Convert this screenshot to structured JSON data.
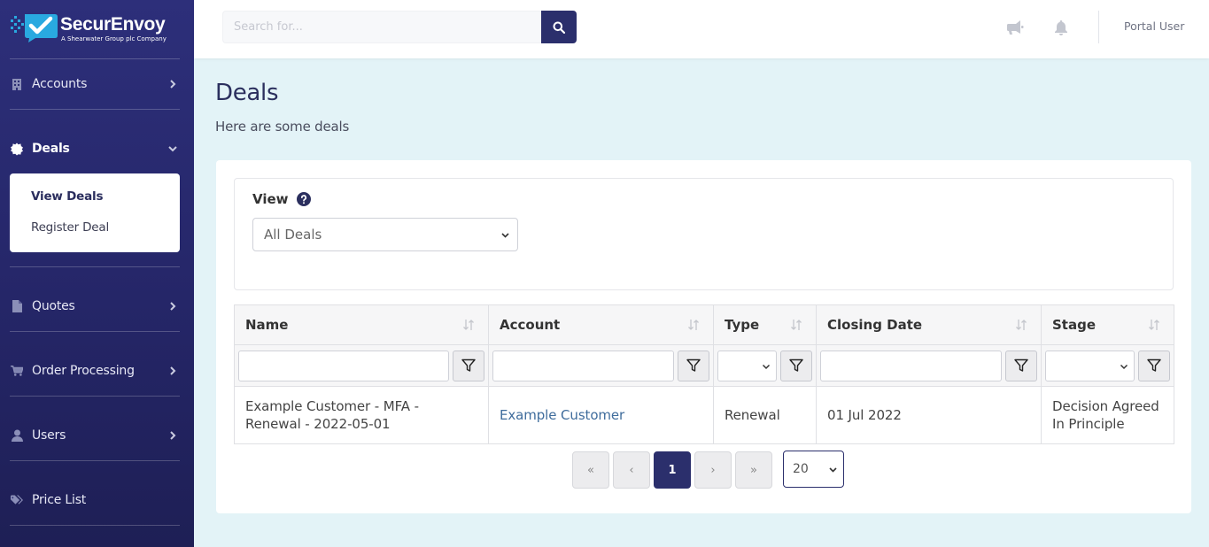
{
  "brand": {
    "name": "SecurEnvoy",
    "tagline": "A Shearwater Group plc Company",
    "accent": "#2b2f6c",
    "logo_blue": "#29a9e0"
  },
  "sidebar": {
    "items": [
      {
        "label": "Accounts",
        "icon": "building-icon"
      },
      {
        "label": "Deals",
        "icon": "badge-icon"
      },
      {
        "label": "Quotes",
        "icon": "file-icon"
      },
      {
        "label": "Order Processing",
        "icon": "cart-icon"
      },
      {
        "label": "Users",
        "icon": "user-icon"
      },
      {
        "label": "Price List",
        "icon": "tags-icon"
      }
    ],
    "deals_submenu": [
      {
        "label": "View Deals"
      },
      {
        "label": "Register Deal"
      }
    ]
  },
  "header": {
    "search_placeholder": "Search for...",
    "user": "Portal User"
  },
  "main": {
    "title": "Deals",
    "subtitle": "Here are some deals",
    "view_label": "View",
    "view_selected": "All Deals"
  },
  "table": {
    "columns": [
      "Name",
      "Account",
      "Type",
      "Closing Date",
      "Stage"
    ],
    "rows": [
      {
        "name": "Example Customer - MFA - Renewal - 2022-05-01",
        "account": "Example Customer",
        "type": "Renewal",
        "closing_date": "01 Jul 2022",
        "stage": "Decision Agreed In Principle"
      }
    ]
  },
  "pagination": {
    "first": "«",
    "prev": "‹",
    "current": "1",
    "next": "›",
    "last": "»",
    "page_size": "20"
  }
}
